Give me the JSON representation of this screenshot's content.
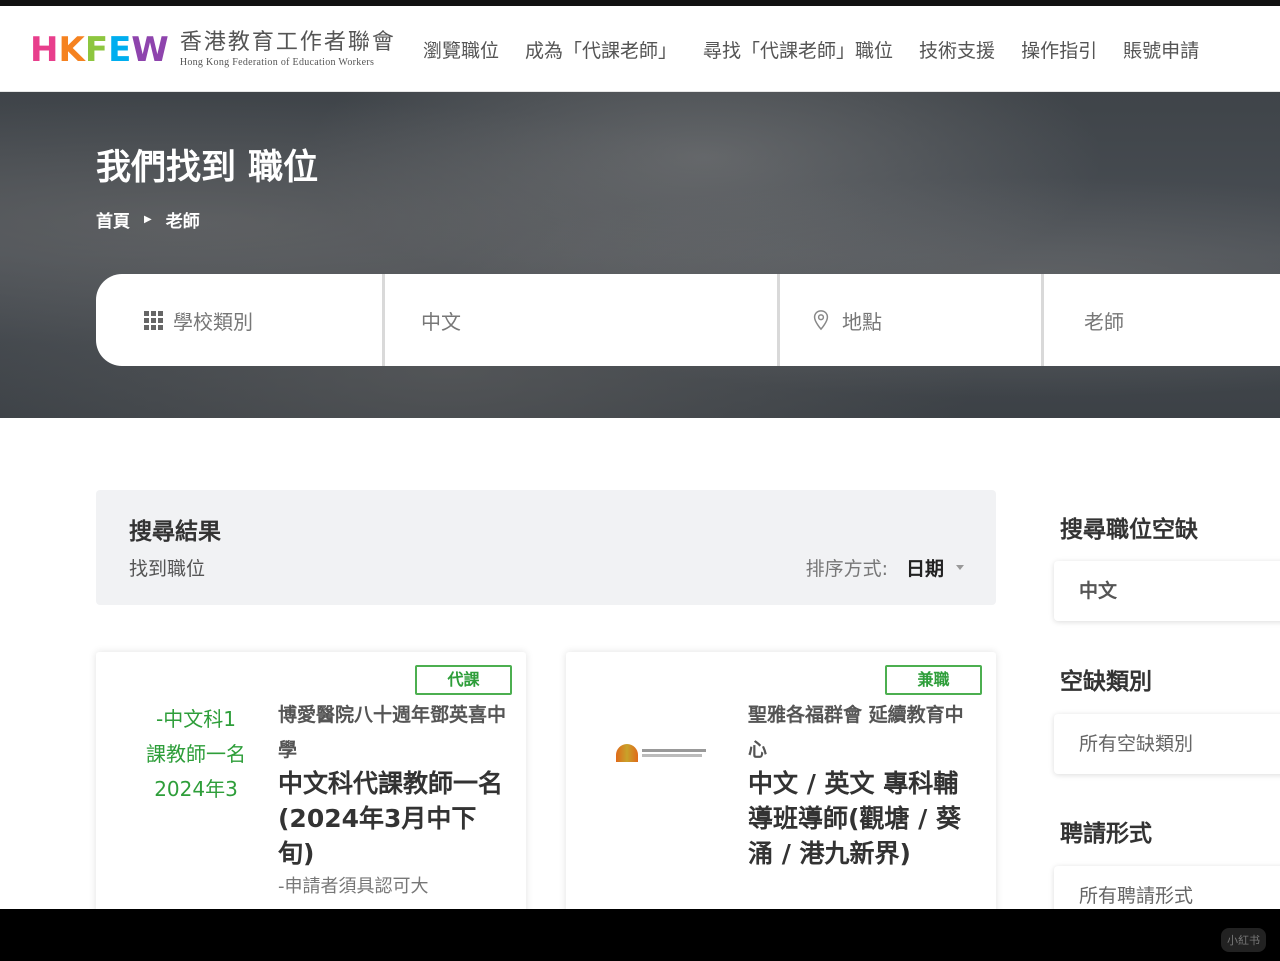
{
  "header": {
    "logo_letters": [
      "H",
      "K",
      "F",
      "E",
      "W"
    ],
    "logo_colors": [
      "#e83e8c",
      "#f58220",
      "#8dc63f",
      "#00aeef",
      "#8e44ad"
    ],
    "logo_zh": "香港教育工作者聯會",
    "logo_en": "Hong Kong Federation of Education Workers",
    "nav": [
      "瀏覽職位",
      "成為「代課老師」",
      "尋找「代課老師」職位",
      "技術支援",
      "操作指引",
      "賬號申請"
    ]
  },
  "hero": {
    "title": "我們找到 職位",
    "breadcrumb": [
      "首頁",
      "老師"
    ],
    "search": {
      "category": "學校類別",
      "keyword": "中文",
      "location": "地點",
      "job": "老師"
    }
  },
  "results": {
    "title": "搜尋結果",
    "subtitle": "找到職位",
    "sort_label": "排序方式:",
    "sort_value": "日期"
  },
  "cards": [
    {
      "badge": "代課",
      "thumb_lines": [
        "-中文科1",
        "課教師一名",
        "2024年3"
      ],
      "org": "博愛醫院八十週年鄧英喜中學",
      "title": "中文科代課教師一名(2024年3月中下旬)",
      "requirement": "-申請者須具認可大"
    },
    {
      "badge": "兼職",
      "org": "聖雅各福群會 延續教育中心",
      "title": "中文 / 英文 專科輔導班導師(觀塘 / 葵涌 / 港九新界)"
    }
  ],
  "sidebar": {
    "search_title": "搜尋職位空缺",
    "search_value": "中文",
    "vacancy_title": "空缺類別",
    "vacancy_value": "所有空缺類別",
    "employment_title": "聘請形式",
    "employment_value": "所有聘請形式"
  },
  "watermark": "小紅书"
}
